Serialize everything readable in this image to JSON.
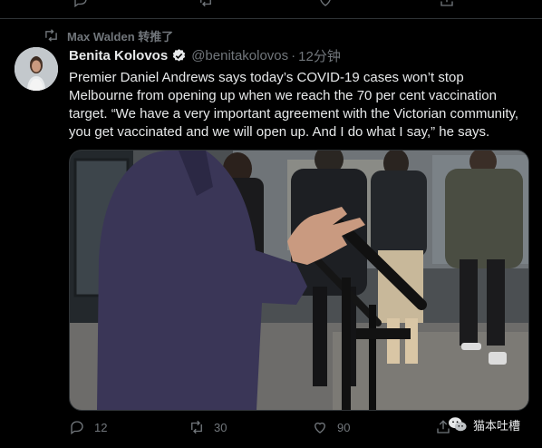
{
  "retweet": {
    "text": "Max Walden 转推了",
    "icon": "retweet-icon"
  },
  "author": {
    "name": "Benita Kolovos",
    "handle": "@benitakolovos",
    "separator": "·",
    "time": "12分钟",
    "verified_icon": "verified-badge-icon"
  },
  "tweet": {
    "lines": [
      "Premier Daniel Andrews says today’s COVID-19 cases won’t stop",
      "Melbourne from opening up when we reach the 70 per cent vaccination",
      "target. “We have a very important agreement with the Victorian community,",
      "you get vaccinated and we will open up. And I do what I say,” he says."
    ]
  },
  "actions": {
    "replies": "12",
    "retweets": "30",
    "likes": "90"
  },
  "watermark": {
    "text": "猫本吐槽",
    "icon": "wechat-icon"
  },
  "colors": {
    "background": "#000000",
    "text": "#e7e9ea",
    "muted": "#71767b",
    "verified": "#e7e9ea",
    "border": "#2f3336"
  }
}
